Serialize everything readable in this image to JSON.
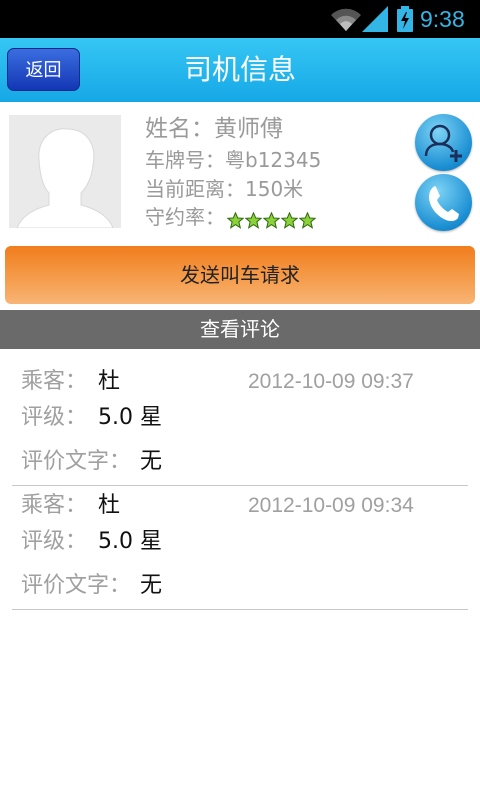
{
  "status_bar": {
    "time": "9:38",
    "icons": [
      "wifi-icon",
      "signal-icon",
      "battery-charging-icon"
    ],
    "color": "#33b5e5"
  },
  "header": {
    "back_label": "返回",
    "title": "司机信息",
    "bg_color": "#16a8e6"
  },
  "driver": {
    "name_label": "姓名：",
    "name": "黄师傅",
    "plate_label": "车牌号：",
    "plate": "粤b12345",
    "distance_label": "当前距离：",
    "distance": "150米",
    "rating_label": "守约率：",
    "rating_stars": 5,
    "actions": [
      "add-contact-icon",
      "phone-icon"
    ]
  },
  "send_request_label": "发送叫车请求",
  "reviews_header": "查看评论",
  "reviews": [
    {
      "passenger_label": "乘客：",
      "passenger": "杜",
      "date": "2012-10-09 09:37",
      "rating_label": "评级：",
      "rating": "5.0 星",
      "text_label": "评价文字：",
      "text": "无"
    },
    {
      "passenger_label": "乘客：",
      "passenger": "杜",
      "date": "2012-10-09 09:34",
      "rating_label": "评级：",
      "rating": "5.0 星",
      "text_label": "评价文字：",
      "text": "无"
    }
  ],
  "colors": {
    "accent_orange": "#f07d1c",
    "star_green": "#8ad13a",
    "section_gray": "#6a6a6a"
  }
}
